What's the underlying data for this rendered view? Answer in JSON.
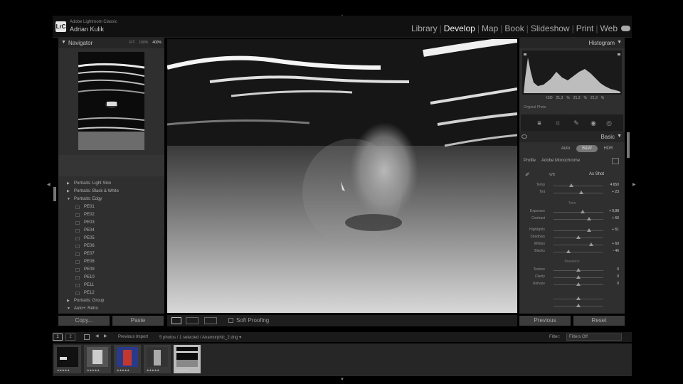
{
  "app": {
    "logo": "LrC",
    "brand_line1": "Adobe Lightroom Classic",
    "brand_line2": "Adrian Kulik"
  },
  "modules": [
    {
      "label": "Library",
      "active": false
    },
    {
      "label": "Develop",
      "active": true
    },
    {
      "label": "Map",
      "active": false
    },
    {
      "label": "Book",
      "active": false
    },
    {
      "label": "Slideshow",
      "active": false
    },
    {
      "label": "Print",
      "active": false
    },
    {
      "label": "Web",
      "active": false
    }
  ],
  "navigator": {
    "title": "Navigator",
    "zoom_fit": "FIT",
    "zoom_100": "100%",
    "zoom_400": "400%"
  },
  "presets": [
    {
      "label": "Portraits: Light Skin",
      "tri": "▶",
      "child": false
    },
    {
      "label": "Portraits: Black & White",
      "tri": "▶",
      "child": false
    },
    {
      "label": "Portraits: Edgy",
      "tri": "▼",
      "child": false
    },
    {
      "label": "PE01",
      "child": true
    },
    {
      "label": "PE02",
      "child": true
    },
    {
      "label": "PE03",
      "child": true
    },
    {
      "label": "PE04",
      "child": true
    },
    {
      "label": "PE05",
      "child": true
    },
    {
      "label": "PE06",
      "child": true
    },
    {
      "label": "PE07",
      "child": true
    },
    {
      "label": "PE08",
      "child": true
    },
    {
      "label": "PE09",
      "child": true
    },
    {
      "label": "PE10",
      "child": true
    },
    {
      "label": "PE11",
      "child": true
    },
    {
      "label": "PE12",
      "child": true
    },
    {
      "label": "Portraits: Group",
      "tri": "▶",
      "child": false
    },
    {
      "label": "Auto+: Retro",
      "tri": "▼",
      "child": false
    }
  ],
  "left_buttons": {
    "copy": "Copy...",
    "paste": "Paste"
  },
  "toolbar": {
    "soft_proofing": "Soft Proofing"
  },
  "histogram": {
    "title": "Histogram",
    "iso": "ISO",
    "info": [
      "21,3",
      "%",
      "21,3",
      "%",
      "21,3",
      "%"
    ],
    "original_photo": "Original Photo"
  },
  "basic": {
    "title": "Basic",
    "modes": [
      {
        "label": "Auto",
        "selected": false
      },
      {
        "label": "B&W",
        "selected": true
      },
      {
        "label": "HDR",
        "selected": false
      }
    ],
    "profile_label": "Profile",
    "profile_value": "Adobe Monochrome",
    "wb_label": "WB",
    "wb_value": "As Shot",
    "sliders_wb": [
      {
        "name": "Temp",
        "value": "4 650",
        "pos": 0.35
      },
      {
        "name": "Tint",
        "value": "+ 23",
        "pos": 0.55
      }
    ],
    "tone_label": "Tone",
    "sliders_tone": [
      {
        "name": "Exposure",
        "value": "+ 0,88",
        "pos": 0.58
      },
      {
        "name": "Contrast",
        "value": "+ 60",
        "pos": 0.72
      }
    ],
    "sliders_tone2": [
      {
        "name": "Highlights",
        "value": "+ 61",
        "pos": 0.72
      },
      {
        "name": "Shadows",
        "value": "",
        "pos": 0.5
      },
      {
        "name": "Whites",
        "value": "+ 69",
        "pos": 0.75
      },
      {
        "name": "Blacks",
        "value": "- 46",
        "pos": 0.3
      }
    ],
    "presence_label": "Presence",
    "sliders_presence": [
      {
        "name": "Texture",
        "value": "0",
        "pos": 0.5
      },
      {
        "name": "Clarity",
        "value": "0",
        "pos": 0.5
      },
      {
        "name": "Dehaze",
        "value": "0",
        "pos": 0.5
      }
    ],
    "sliders_extra": [
      {
        "name": "",
        "value": "",
        "pos": 0.5
      },
      {
        "name": "",
        "value": "",
        "pos": 0.5
      }
    ]
  },
  "right_buttons": {
    "previous": "Previous",
    "reset": "Reset"
  },
  "filmstrip_bar": {
    "view1": "1",
    "view2": "2",
    "back": "◀",
    "forward": "▶",
    "source": "Previous Import",
    "count": "5 photos / 1 selected / Anamorphic_2.dng ▾",
    "filter_label": "Filter:",
    "filter_value": "Filters Off"
  },
  "filmstrip": [
    {
      "stars": "★★★★★",
      "selected": false
    },
    {
      "stars": "★★★★★",
      "selected": false
    },
    {
      "stars": "★★★★★",
      "selected": false
    },
    {
      "stars": "★★★★★",
      "selected": false
    },
    {
      "stars": "★★★★★",
      "selected": true
    }
  ]
}
